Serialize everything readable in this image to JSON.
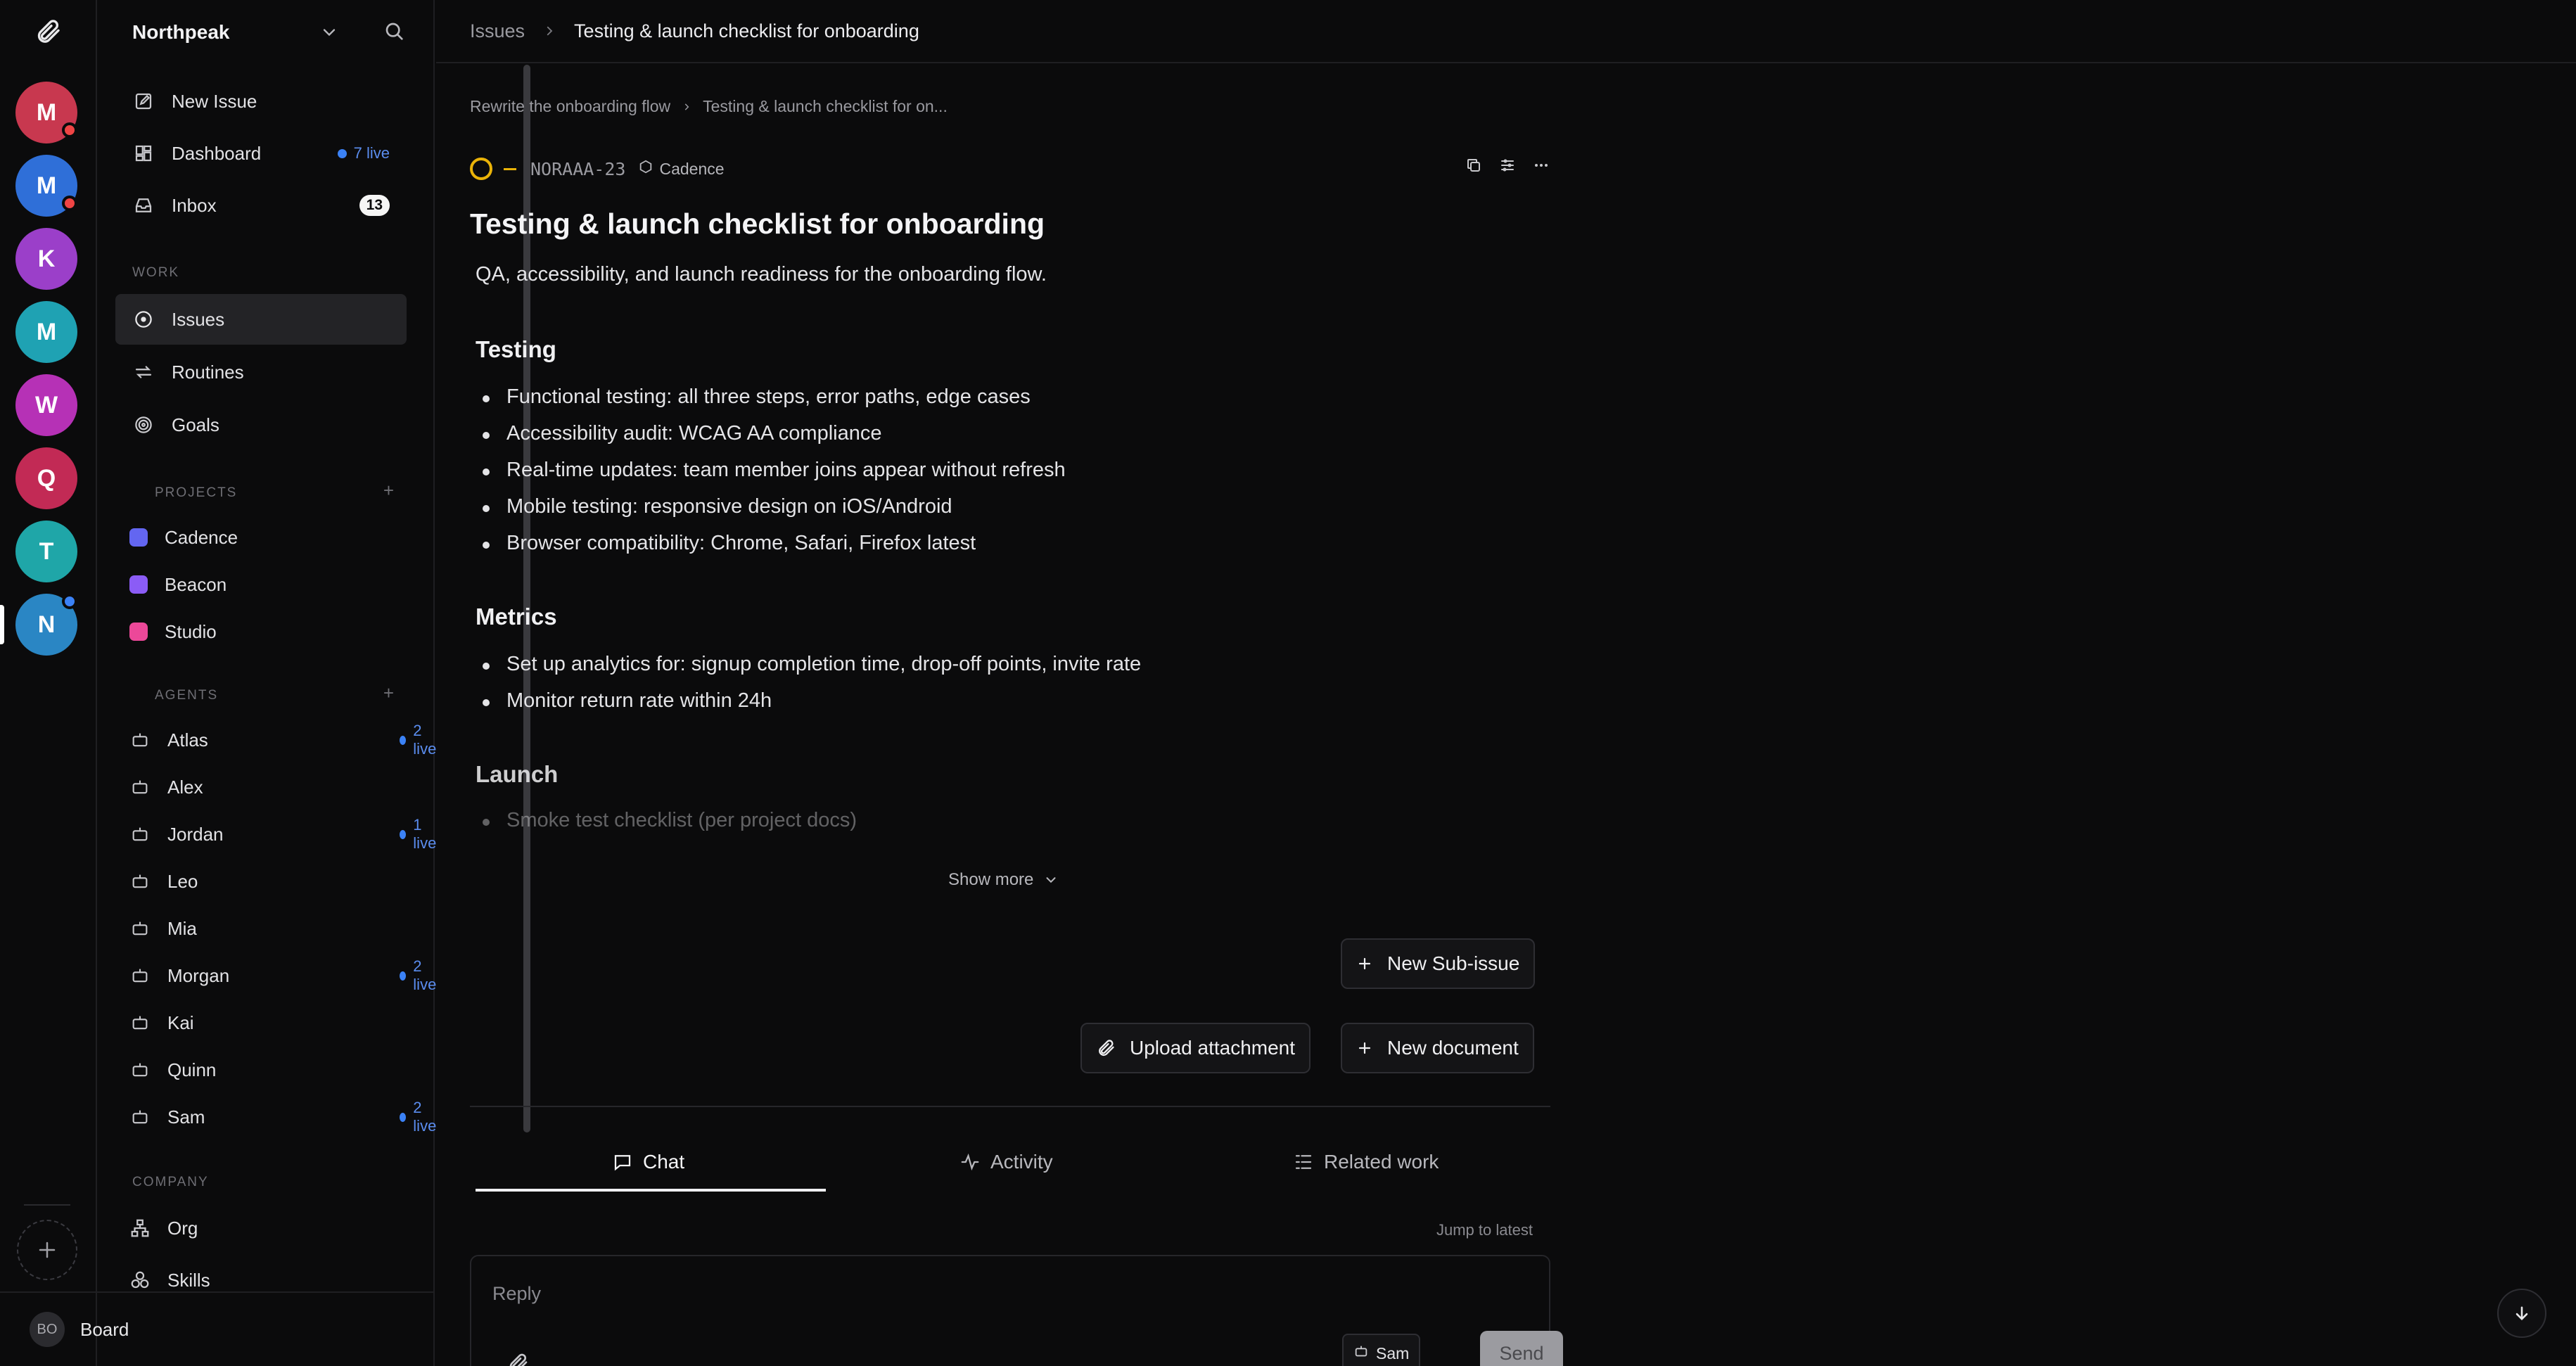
{
  "rail": {
    "workspaces": [
      {
        "letter": "M",
        "color": "#c8384f",
        "dot": "#ef4444"
      },
      {
        "letter": "M",
        "color": "#2f6fd8",
        "dot": "#ef4444"
      },
      {
        "letter": "K",
        "color": "#9b3fc9",
        "dot": ""
      },
      {
        "letter": "M",
        "color": "#1fa2b3",
        "dot": ""
      },
      {
        "letter": "W",
        "color": "#b631b6",
        "dot": ""
      },
      {
        "letter": "Q",
        "color": "#c22a55",
        "dot": ""
      },
      {
        "letter": "T",
        "color": "#1fa6a8",
        "dot": ""
      },
      {
        "letter": "N",
        "color": "#2a86c4",
        "dot": "#3b82f6"
      }
    ]
  },
  "sidebar": {
    "org": "Northpeak",
    "nav": [
      {
        "label": "New Issue",
        "icon": "pencil-square-icon"
      },
      {
        "label": "Dashboard",
        "icon": "dashboard-icon",
        "meta": "7 live"
      },
      {
        "label": "Inbox",
        "icon": "inbox-icon",
        "badge": "13"
      }
    ],
    "work_label": "WORK",
    "work": [
      {
        "label": "Issues",
        "icon": "circle-dot-icon",
        "active": true
      },
      {
        "label": "Routines",
        "icon": "repeat-icon"
      },
      {
        "label": "Goals",
        "icon": "target-icon"
      }
    ],
    "projects_label": "PROJECTS",
    "projects": [
      {
        "label": "Cadence",
        "color": "#6366f1"
      },
      {
        "label": "Beacon",
        "color": "#8b5cf6"
      },
      {
        "label": "Studio",
        "color": "#ec4899"
      }
    ],
    "agents_label": "AGENTS",
    "agents": [
      {
        "label": "Atlas",
        "meta": "2 live"
      },
      {
        "label": "Alex",
        "meta": ""
      },
      {
        "label": "Jordan",
        "meta": "1 live"
      },
      {
        "label": "Leo",
        "meta": ""
      },
      {
        "label": "Mia",
        "meta": ""
      },
      {
        "label": "Morgan",
        "meta": "2 live"
      },
      {
        "label": "Kai",
        "meta": ""
      },
      {
        "label": "Quinn",
        "meta": ""
      },
      {
        "label": "Sam",
        "meta": "2 live"
      }
    ],
    "company_label": "COMPANY",
    "company": [
      {
        "label": "Org",
        "icon": "org-chart-icon"
      },
      {
        "label": "Skills",
        "icon": "skills-icon"
      }
    ],
    "footer": {
      "initials": "BO",
      "name": "Board"
    }
  },
  "topbar": {
    "crumb1": "Issues",
    "crumb2": "Testing & launch checklist for onboarding"
  },
  "issue": {
    "parent": "Rewrite the onboarding flow",
    "current": "Testing & launch checklist for on...",
    "id": "NORAAA-23",
    "project": "Cadence",
    "title": "Testing & launch checklist for onboarding",
    "description": "QA, accessibility, and launch readiness for the onboarding flow.",
    "sections": [
      {
        "heading": "Testing",
        "items": [
          "Functional testing: all three steps, error paths, edge cases",
          "Accessibility audit: WCAG AA compliance",
          "Real-time updates: team member joins appear without refresh",
          "Mobile testing: responsive design on iOS/Android",
          "Browser compatibility: Chrome, Safari, Firefox latest"
        ]
      },
      {
        "heading": "Metrics",
        "items": [
          "Set up analytics for: signup completion time, drop-off points, invite rate",
          "Monitor return rate within 24h"
        ]
      },
      {
        "heading": "Launch",
        "items": [
          "Smoke test checklist (per project docs)"
        ]
      }
    ],
    "show_more": "Show more",
    "new_sub_issue": "New Sub-issue",
    "upload_attachment": "Upload attachment",
    "new_document": "New document"
  },
  "tabs": [
    {
      "label": "Chat",
      "active": true
    },
    {
      "label": "Activity"
    },
    {
      "label": "Related work"
    }
  ],
  "jump_latest": "Jump to latest",
  "reply": {
    "placeholder": "Reply",
    "agent": "Sam",
    "send": "Send"
  }
}
